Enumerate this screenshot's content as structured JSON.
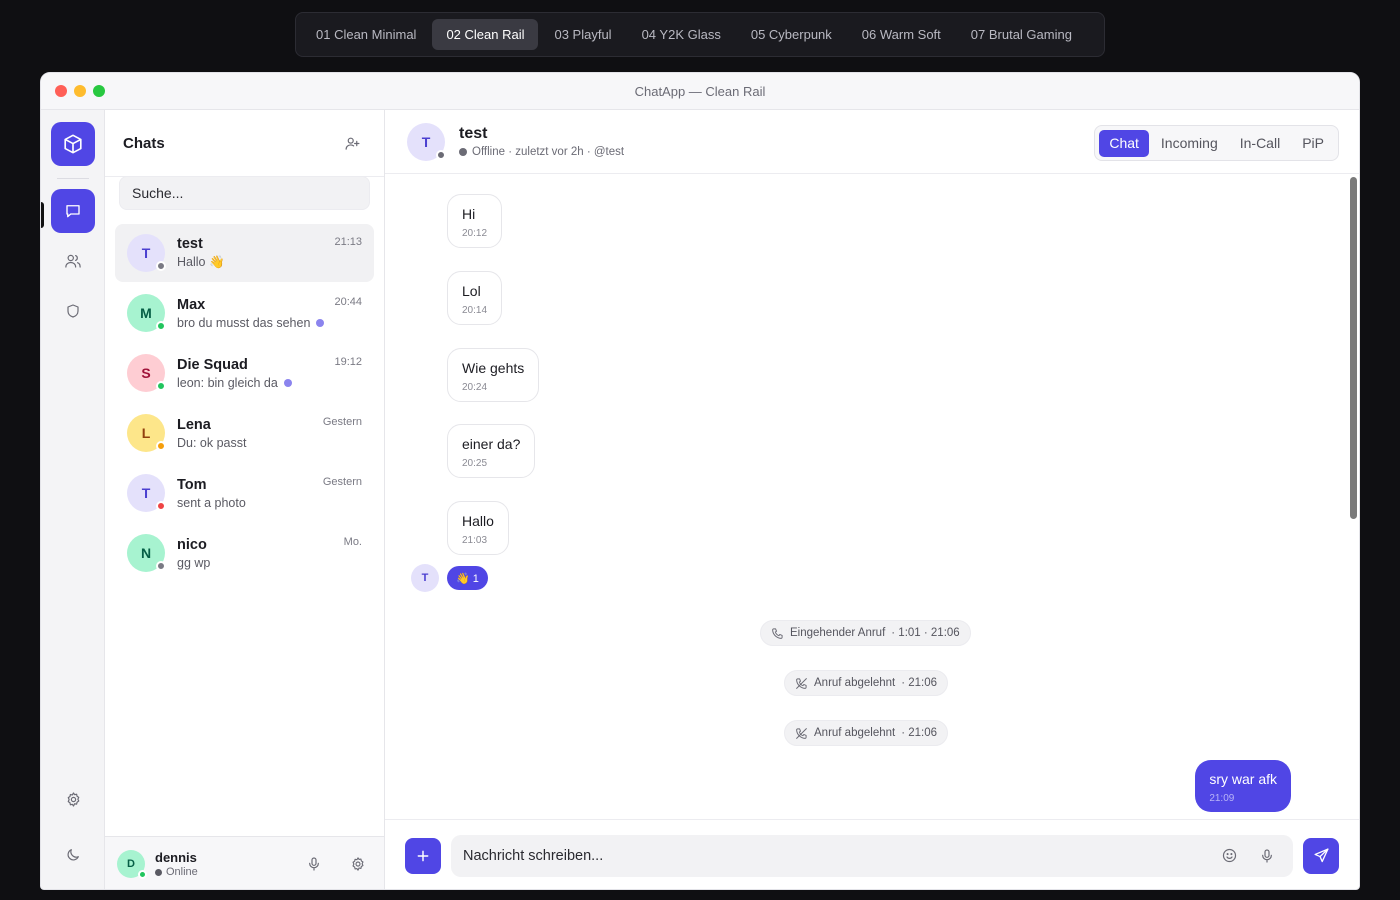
{
  "theme_tabs": [
    "01 Clean Minimal",
    "02 Clean Rail",
    "03 Playful",
    "04 Y2K Glass",
    "05 Cyberpunk",
    "06 Warm Soft",
    "07 Brutal Gaming"
  ],
  "window": {
    "title": "ChatApp — Clean Rail"
  },
  "sidebar": {
    "title": "Chats",
    "search_placeholder": "Suche...",
    "chats": [
      {
        "initial": "T",
        "name": "test",
        "time": "21:13",
        "preview": "Hallo 👋",
        "status_color": "#7a7a84",
        "avatar_bg": "#e4e1fb",
        "avatar_fg": "#4b3fd0"
      },
      {
        "initial": "M",
        "name": "Max",
        "time": "20:44",
        "preview": "bro du musst das sehen",
        "status_color": "#22c55e",
        "avatar_bg": "#a7f3d0",
        "avatar_fg": "#065f46"
      },
      {
        "initial": "S",
        "name": "Die Squad",
        "time": "19:12",
        "preview": "leon: bin gleich da",
        "status_color": "#22c55e",
        "avatar_bg": "#fecdd3",
        "avatar_fg": "#9f1239"
      },
      {
        "initial": "L",
        "name": "Lena",
        "time": "Gestern",
        "preview": "Du: ok passt",
        "status_color": "#f59e0b",
        "avatar_bg": "#fde68a",
        "avatar_fg": "#92400e"
      },
      {
        "initial": "T",
        "name": "Tom",
        "time": "Gestern",
        "preview": "sent a photo",
        "status_color": "#ef4444",
        "avatar_bg": "#e4e1fb",
        "avatar_fg": "#4b3fd0"
      },
      {
        "initial": "N",
        "name": "nico",
        "time": "Mo.",
        "preview": "gg wp",
        "status_color": "#7a7a84",
        "avatar_bg": "#a7f3d0",
        "avatar_fg": "#065f46"
      }
    ],
    "me": {
      "initial": "D",
      "name": "dennis",
      "status": "Online"
    }
  },
  "conversation": {
    "contact_initial": "T",
    "contact_name": "test",
    "contact_status": "Offline · zuletzt vor 2h · @test",
    "view_tabs": [
      "Chat",
      "Incoming",
      "In-Call",
      "PiP"
    ],
    "messages": [
      {
        "text": "Hi",
        "time": "20:12"
      },
      {
        "text": "Lol",
        "time": "20:14"
      },
      {
        "text": "Wie gehts",
        "time": "20:24"
      },
      {
        "text": "einer da?",
        "time": "20:25"
      },
      {
        "text": "Hallo",
        "time": "21:03"
      }
    ],
    "reaction_avatar": "T",
    "reaction": "👋 1",
    "events": [
      {
        "label": "Eingehender Anruf",
        "detail": "· 1:01  · 21:06"
      },
      {
        "label": "Anruf abgelehnt",
        "detail": "· 21:06"
      },
      {
        "label": "Anruf abgelehnt",
        "detail": "· 21:06"
      }
    ],
    "outgoing": {
      "text": "sry war afk",
      "time": "21:09"
    },
    "composer_placeholder": "Nachricht schreiben..."
  },
  "colors": {
    "accent": "#5046e5",
    "online": "#22c55e",
    "offline": "#7a7a84"
  }
}
